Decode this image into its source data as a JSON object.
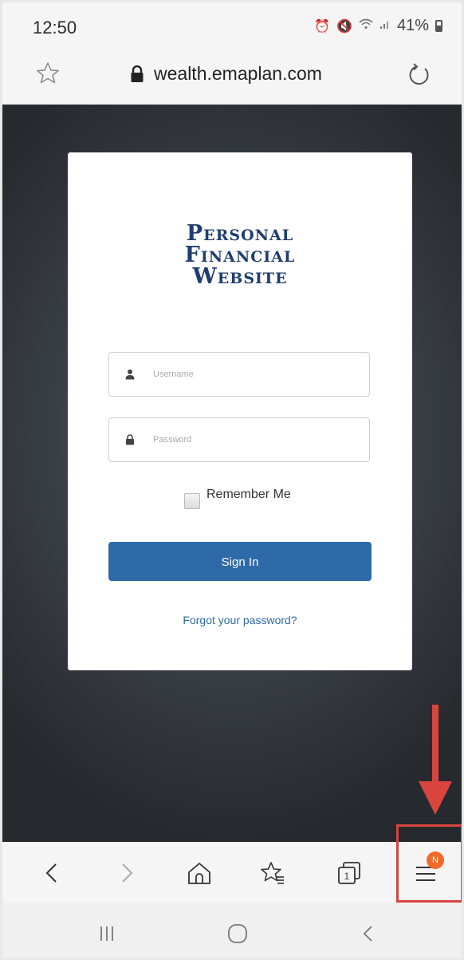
{
  "status_bar": {
    "time": "12:50",
    "battery": "41%",
    "icons": [
      "alarm-icon",
      "mute-icon",
      "wifi-icon",
      "signal-icon",
      "battery-icon"
    ]
  },
  "browser": {
    "url": "wealth.emaplan.com",
    "icons": [
      "star-icon",
      "lock-icon",
      "reload-icon"
    ]
  },
  "login": {
    "brand_lines": [
      "Personal",
      "Financial",
      "Website"
    ],
    "username_placeholder": "Username",
    "password_placeholder": "Password",
    "remember_label": "Remember Me",
    "sign_in_label": "Sign In",
    "forgot_label": "Forgot your password?",
    "brand_color": "#1f3d6e",
    "button_color": "#2f6aa8"
  },
  "bottom_nav": {
    "icons": [
      "back-icon",
      "forward-icon",
      "home-icon",
      "bookmarks-icon",
      "tabs-icon",
      "menu-icon"
    ],
    "tabs_count": "1",
    "menu_badge": "N"
  },
  "system_nav": {
    "icons": [
      "recent-apps-icon",
      "home-circle-icon",
      "system-back-icon"
    ]
  },
  "annotation": {
    "color": "#d9443f"
  }
}
